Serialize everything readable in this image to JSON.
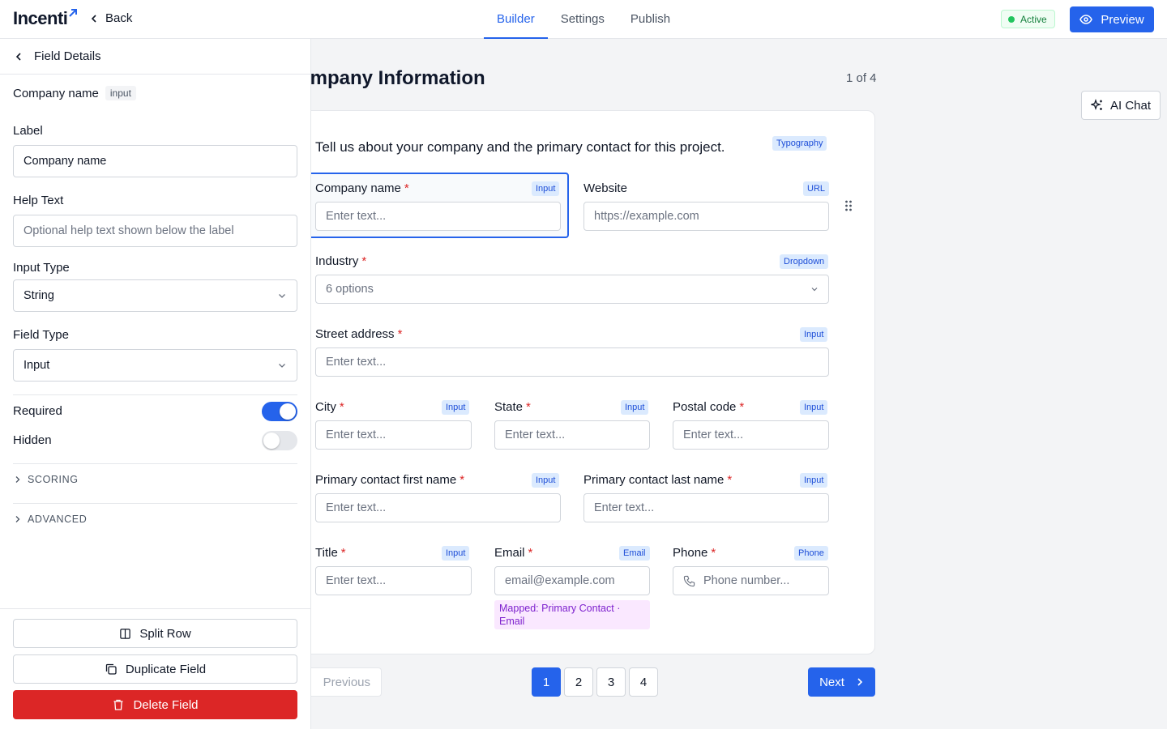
{
  "header": {
    "logo": "Incenti",
    "back_label": "Back",
    "tabs": [
      {
        "label": "Builder",
        "active": true
      },
      {
        "label": "Settings",
        "active": false
      },
      {
        "label": "Publish",
        "active": false
      }
    ],
    "status": "Active",
    "preview_label": "Preview"
  },
  "left_panel": {
    "title": "Field Details",
    "field_name": "Company name",
    "field_kind": "input",
    "label_label": "Label",
    "label_value": "Company name",
    "help_label": "Help Text",
    "help_placeholder": "Optional help text shown below the label",
    "input_type_label": "Input Type",
    "input_type_value": "String",
    "field_type_label": "Field Type",
    "field_type_value": "Input",
    "required_label": "Required",
    "required_on": true,
    "hidden_label": "Hidden",
    "hidden_on": false,
    "sections": [
      "SCORING",
      "ADVANCED"
    ],
    "split_row": "Split Row",
    "duplicate": "Duplicate Field",
    "delete": "Delete Field"
  },
  "canvas": {
    "title": "Company Information",
    "visible_title": "ompany Information",
    "page_count": "1 of 4",
    "ai_chat": "AI Chat",
    "intro": "Tell us about your company and the primary contact for this project.",
    "intro_tag": "Typography",
    "req_mark": "*",
    "fields": {
      "company_name": {
        "label": "Company name",
        "tag": "Input",
        "placeholder": "Enter text..."
      },
      "website": {
        "label": "Website",
        "tag": "URL",
        "placeholder": "https://example.com"
      },
      "industry": {
        "label": "Industry",
        "tag": "Dropdown",
        "placeholder": "6 options"
      },
      "street": {
        "label": "Street address",
        "tag": "Input",
        "placeholder": "Enter text..."
      },
      "city": {
        "label": "City",
        "tag": "Input",
        "placeholder": "Enter text..."
      },
      "state": {
        "label": "State",
        "tag": "Input",
        "placeholder": "Enter text..."
      },
      "postal": {
        "label": "Postal code",
        "tag": "Input",
        "placeholder": "Enter text..."
      },
      "first_name": {
        "label": "Primary contact first name",
        "tag": "Input",
        "placeholder": "Enter text..."
      },
      "last_name": {
        "label": "Primary contact last name",
        "tag": "Input",
        "placeholder": "Enter text..."
      },
      "title": {
        "label": "Title",
        "tag": "Input",
        "placeholder": "Enter text..."
      },
      "email": {
        "label": "Email",
        "tag": "Email",
        "placeholder": "email@example.com",
        "mapped": "Mapped: Primary Contact · Email"
      },
      "phone": {
        "label": "Phone",
        "tag": "Phone",
        "placeholder": "Phone number..."
      }
    }
  },
  "pagination": {
    "previous": "Previous",
    "pages": [
      "1",
      "2",
      "3",
      "4"
    ],
    "current": "1",
    "next": "Next"
  },
  "colors": {
    "accent": "#2563eb",
    "danger": "#dc2626",
    "success": "#22c55e"
  }
}
